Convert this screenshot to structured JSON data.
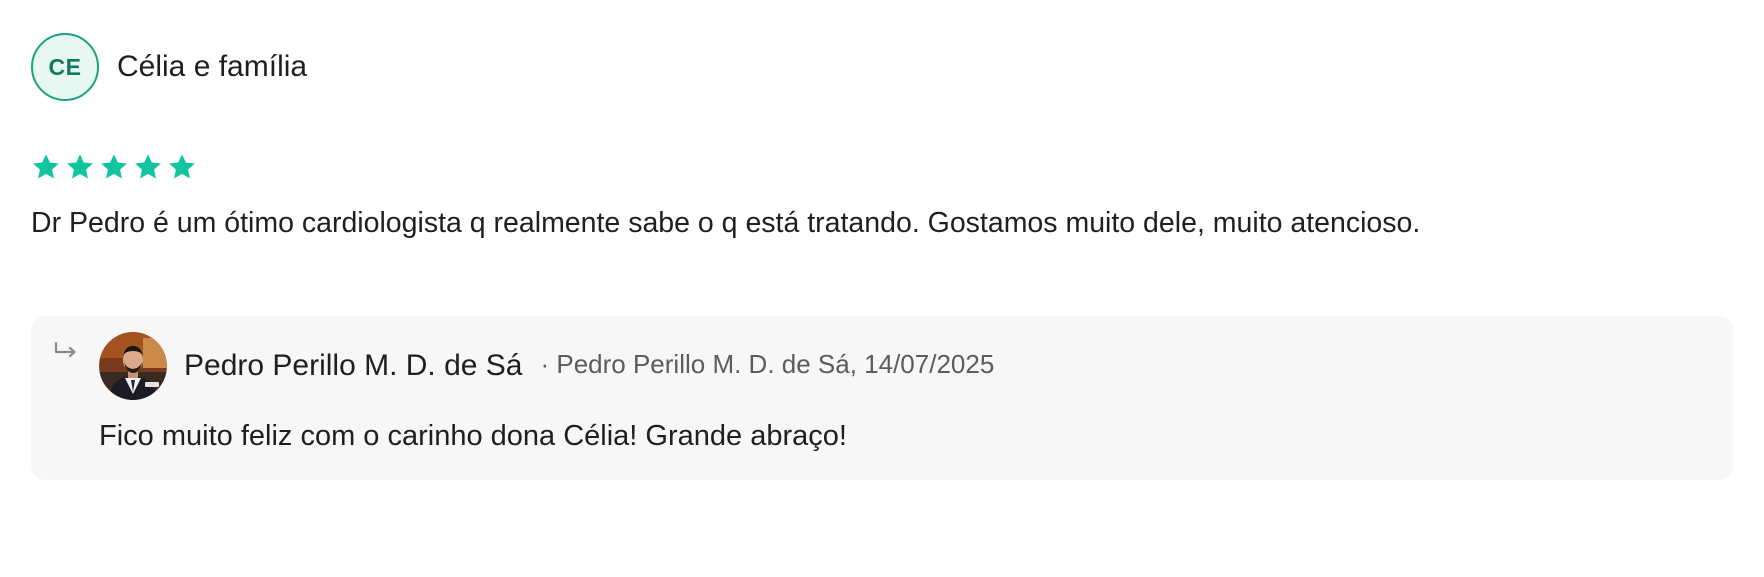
{
  "review": {
    "author_initials": "CE",
    "author_name": "Célia e família",
    "rating": 5,
    "rating_max": 5,
    "star_color": "#12c4a0",
    "text": "Dr Pedro é um ótimo cardiologista q realmente sabe o q está tratando. Gostamos muito dele, muito atencioso."
  },
  "reply": {
    "author_name": "Pedro Perillo M. D. de Sá",
    "meta": "· Pedro Perillo M. D. de Sá, 14/07/2025",
    "text": "Fico muito feliz com o carinho dona Célia! Grande abraço!"
  },
  "colors": {
    "accent": "#1aa37d",
    "reply_background": "#f7f7f7",
    "muted_text": "#5c5c5c"
  },
  "icons": {
    "star": "star-icon",
    "reply": "reply-arrow-icon"
  }
}
